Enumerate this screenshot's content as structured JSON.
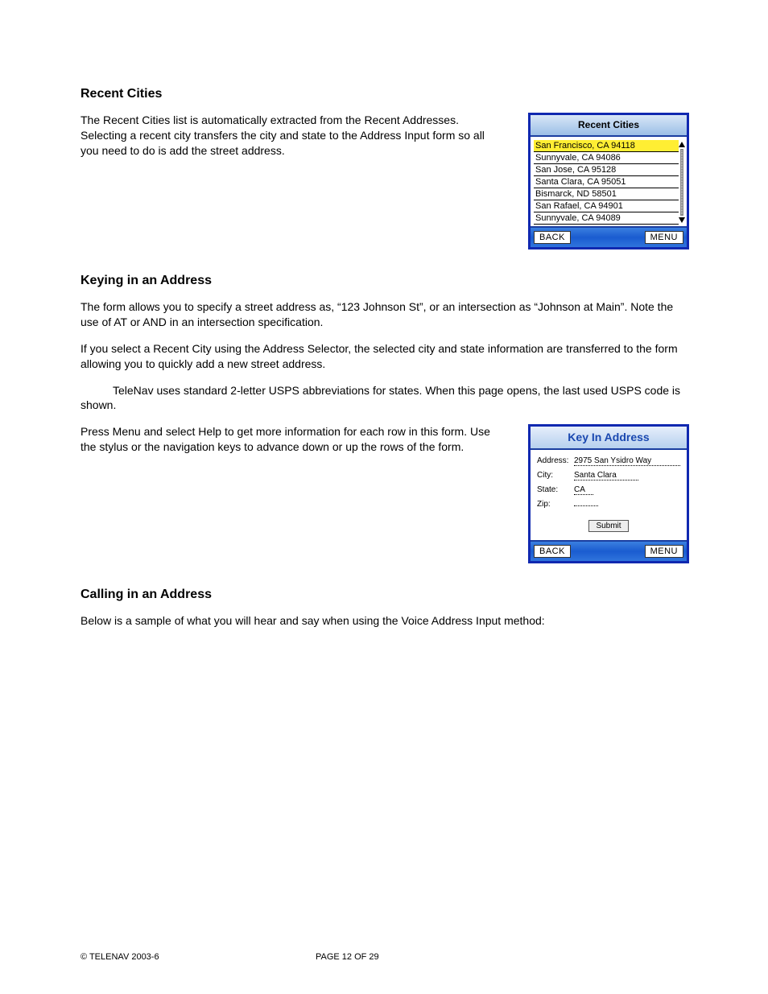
{
  "sections": {
    "recentCities": {
      "heading": "Recent Cities",
      "p1": "The Recent Cities list is automatically extracted from the Recent Addresses. Selecting a recent city transfers the city and state to the Address Input form so all you need to do is add the street address."
    },
    "keying": {
      "heading": "Keying in an Address",
      "p1": "The form allows you to specify a street address as, “123 Johnson St”, or an intersection as “Johnson at Main”. Note the use of AT or AND in an intersection specification.",
      "p2": "If you select a Recent City using the Address Selector, the selected city and state information are transferred to the form allowing you to quickly add a new street address.",
      "p3a": "TeleNav uses standard 2-letter USPS abbreviations for states.  When this page opens, the last used USPS code is shown.",
      "p4": "Press Menu and select Help to get more information for each row in this form. Use the stylus or the navigation keys to advance down or up the rows of the form."
    },
    "calling": {
      "heading": "Calling in an Address",
      "p1": "Below is a sample of what you will hear and say when using the Voice Address Input method:"
    }
  },
  "recentPanel": {
    "title": "Recent Cities",
    "items": [
      "San Francisco, CA 94118",
      "Sunnyvale, CA 94086",
      "San Jose, CA 95128",
      "Santa Clara, CA 95051",
      "Bismarck, ND 58501",
      "San Rafael, CA 94901",
      "Sunnyvale, CA 94089"
    ],
    "back": "BACK",
    "menu": "MENU"
  },
  "keyinPanel": {
    "title": "Key In Address",
    "labels": {
      "address": "Address:",
      "city": "City:",
      "state": "State:",
      "zip": "Zip:"
    },
    "values": {
      "address": "2975 San Ysidro Way",
      "city": "Santa Clara",
      "state": "CA",
      "zip": ""
    },
    "submit": "Submit",
    "back": "BACK",
    "menu": "MENU"
  },
  "footer": {
    "copyright": "© TELENAV 2003-6",
    "page": "PAGE 12 OF 29"
  }
}
